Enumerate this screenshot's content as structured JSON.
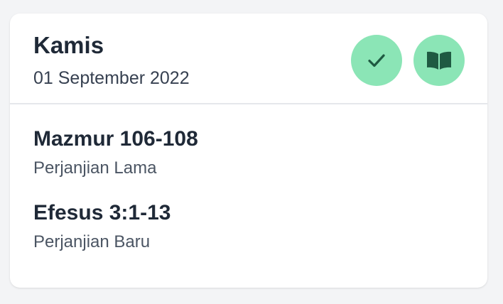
{
  "header": {
    "day": "Kamis",
    "date": "01 September 2022"
  },
  "actions": {
    "check_icon": "check-icon",
    "book_icon": "open-book-icon"
  },
  "readings": [
    {
      "passage": "Mazmur 106-108",
      "testament": "Perjanjian Lama"
    },
    {
      "passage": "Efesus 3:1-13",
      "testament": "Perjanjian Baru"
    }
  ],
  "colors": {
    "accent": "#8be5b6",
    "icon": "#1f5a42",
    "title": "#1f2937",
    "subtitle": "#4b5563",
    "divider": "#e5e7eb"
  }
}
